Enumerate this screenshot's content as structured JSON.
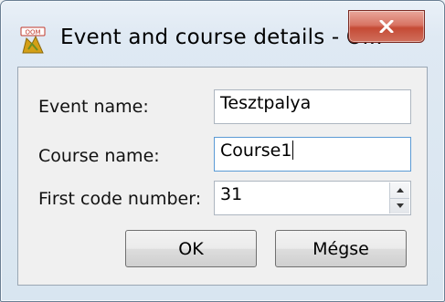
{
  "window": {
    "title": "Event and course details - O..."
  },
  "form": {
    "event_name_label": "Event name:",
    "event_name_value": "Tesztpalya",
    "course_name_label": "Course name:",
    "course_name_value": "Course1",
    "first_code_label": "First code number:",
    "first_code_value": "31"
  },
  "buttons": {
    "ok_label": "OK",
    "cancel_label": "Mégse"
  },
  "colors": {
    "close_button": "#c54a35",
    "dialog_background": "#f0f0f0"
  },
  "icons": {
    "app": "app-icon",
    "close": "close-icon",
    "spin_up": "spin-up-icon",
    "spin_down": "spin-down-icon"
  }
}
